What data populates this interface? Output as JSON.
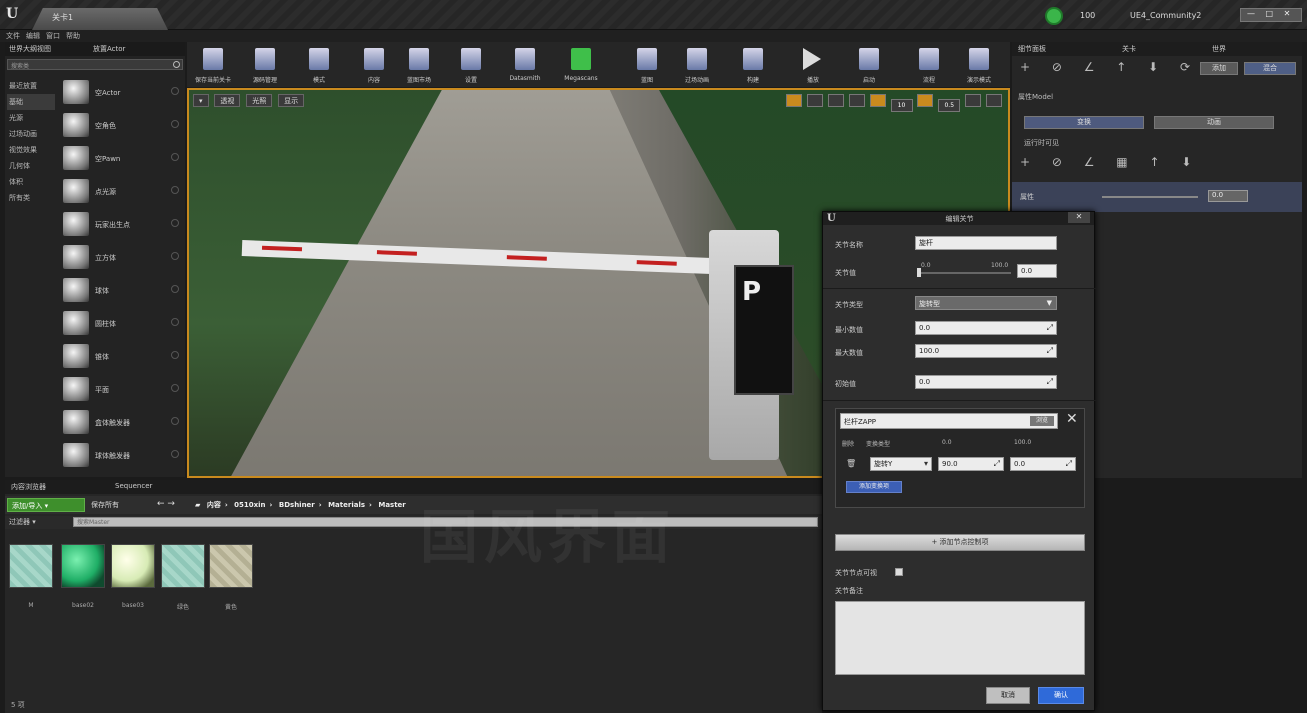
{
  "window": {
    "logo": "U",
    "tab_title": "关卡1",
    "project_name": "UE4_Community2",
    "fps_label": "100",
    "window_buttons": "— □ ✕"
  },
  "menu": {
    "items": [
      "文件",
      "编辑",
      "窗口",
      "帮助"
    ]
  },
  "left_panel": {
    "tabs": [
      "世界大纲视图",
      "放置Actor"
    ],
    "search_placeholder": "搜索类",
    "categories": [
      "最近放置",
      "基础",
      "光源",
      "过场动画",
      "视觉效果",
      "几何体",
      "体积",
      "所有类"
    ],
    "active_category": "基础",
    "assets": [
      "空Actor",
      "空角色",
      "空Pawn",
      "点光源",
      "玩家出生点",
      "立方体",
      "球体",
      "圆柱体",
      "锥体",
      "平面",
      "盒体触发器",
      "球体触发器"
    ]
  },
  "toolbar": {
    "items": [
      {
        "label": "保存当前关卡",
        "icon": "save-icon"
      },
      {
        "label": "源码管理",
        "icon": "source-control-icon"
      },
      {
        "label": "模式",
        "icon": "modes-icon"
      },
      {
        "label": "内容",
        "icon": "content-icon"
      },
      {
        "label": "蓝图市场",
        "icon": "marketplace-icon"
      },
      {
        "label": "设置",
        "icon": "settings-icon"
      },
      {
        "label": "Datasmith",
        "icon": "datasmith-icon"
      },
      {
        "label": "Megascans",
        "icon": "megascans-icon"
      },
      {
        "label": "蓝图",
        "icon": "blueprint-icon"
      },
      {
        "label": "过场动画",
        "icon": "cinematics-icon"
      },
      {
        "label": "构建",
        "icon": "build-icon"
      },
      {
        "label": "播放",
        "icon": "play-icon"
      },
      {
        "label": "启动",
        "icon": "launch-icon"
      },
      {
        "label": "流程",
        "icon": "flow-icon"
      },
      {
        "label": "演示模式",
        "icon": "demo-icon"
      }
    ]
  },
  "viewport": {
    "left_buttons": [
      "▾",
      "透视",
      "光照",
      "显示"
    ],
    "sign_letter": "P",
    "right_value": "10",
    "right_value2": "0.5"
  },
  "right_panel": {
    "tabs": [
      "细节面板",
      "关卡",
      "世界"
    ],
    "buttons": [
      "添加",
      "混合"
    ],
    "section": "属性Model",
    "tab_buttons": [
      "变换",
      "动画"
    ],
    "checkbox_label": "运行时可见",
    "param_label": "属性",
    "param_value": "0.0"
  },
  "content_browser": {
    "tabs": [
      "内容浏览器",
      "Sequencer"
    ],
    "add_import": "添加/导入 ▾",
    "save_all": "保存所有",
    "breadcrumbs": [
      "内容",
      "0510xin",
      "BDshiner",
      "Materials",
      "Master"
    ],
    "filters": "过滤器 ▾",
    "search_placeholder": "搜索Master",
    "materials": [
      "M",
      "base02",
      "base03",
      "绿色",
      "黄色"
    ],
    "status": "5 项"
  },
  "dialog": {
    "title": "编辑关节",
    "fields": {
      "name_label": "关节名称",
      "name_value": "旋杆",
      "value_label": "关节值",
      "slider_lo": "0.0",
      "slider_hi": "100.0",
      "slider_value": "0.0",
      "type_label": "关节类型",
      "type_value": "旋转型",
      "min_label": "最小数值",
      "min_value": "0.0",
      "max_label": "最大数值",
      "max_value": "100.0",
      "init_label": "初始值",
      "init_value": "0.0"
    },
    "sub": {
      "target_value": "栏杆ZAPP",
      "browse": "浏览",
      "col_headers": [
        "删除",
        "变换类型",
        "0.0",
        "100.0"
      ],
      "row_type": "旋转Y",
      "row_start": "90.0",
      "row_end": "0.0",
      "add_transform": "添加变换项"
    },
    "add_button": "+ 添加节点控制项",
    "runtime_label": "关节节点可视",
    "note_label": "关节备注",
    "cancel": "取消",
    "ok": "确认"
  },
  "watermark": "国风界面"
}
